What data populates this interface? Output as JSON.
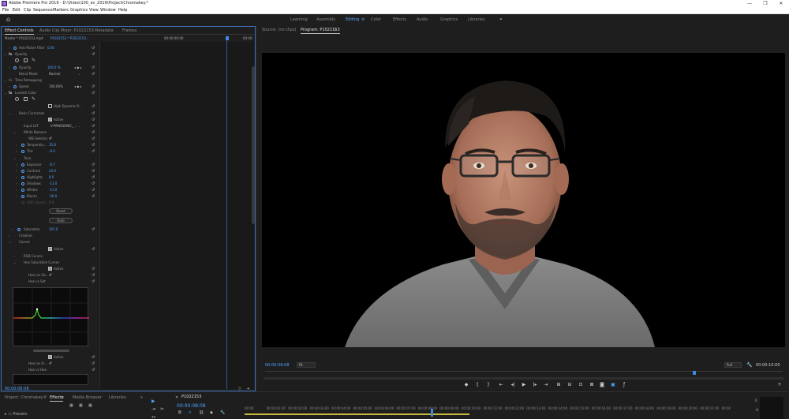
{
  "titlebar": {
    "title": "Adobe Premiere Pro 2019 - D:\\Video\\100_av_2019\\Project\\Chromakey.*",
    "minimize": "—",
    "maximize": "❐",
    "close": "✕"
  },
  "menu": [
    "File",
    "Edit",
    "Clip",
    "Sequence",
    "Markers",
    "Graphics",
    "View",
    "Window",
    "Help"
  ],
  "workspaces": {
    "items": [
      "Learning",
      "Assembly",
      "Editing",
      "Color",
      "Effects",
      "Audio",
      "Graphics",
      "Libraries"
    ],
    "active": "Editing",
    "more": "»"
  },
  "effect_controls": {
    "tabs": [
      "Effect Controls",
      "Audio Clip Mixer: P1022153",
      "Metadata",
      "Frames"
    ],
    "master": "Master * P1022153.mp4",
    "clip": "P1022153 * P1022153...",
    "tc_start": "00:00:00:00",
    "tc_end": "00:00",
    "timecode": "00:00:08:08",
    "rows": {
      "anti_flicker": {
        "label": "Anti-flicker Filter",
        "value": "0.00"
      },
      "opacity": {
        "label": "Opacity"
      },
      "opacity_value": {
        "label": "Opacity",
        "value": "100.0 %"
      },
      "blend_mode": {
        "label": "Blend Mode",
        "value": "Normal"
      },
      "time_remap": {
        "label": "Time Remapping"
      },
      "speed": {
        "label": "Speed",
        "value": "100.00%"
      },
      "lumetri": {
        "label": "Lumetri Color"
      },
      "high_dynamic": {
        "label": "High Dynamic R..."
      },
      "basic_correction": {
        "label": "Basic Correction"
      },
      "active1": {
        "label": "Active"
      },
      "input_lut": {
        "label": "Input LUT",
        "value": "V-PANASONIC_..."
      },
      "white_balance": {
        "label": "White Balance"
      },
      "wb_selector": {
        "label": "WB Selector"
      },
      "temperature": {
        "label": "Temperatu...",
        "value": "35.8"
      },
      "tint": {
        "label": "Tint",
        "value": "-9.0"
      },
      "tone": {
        "label": "Tone"
      },
      "exposure": {
        "label": "Exposure",
        "value": "-0.7"
      },
      "contrast": {
        "label": "Contrast",
        "value": "24.0"
      },
      "highlights": {
        "label": "Highlights",
        "value": "8.0"
      },
      "shadows": {
        "label": "Shadows",
        "value": "-13.0"
      },
      "whites": {
        "label": "Whites",
        "value": "-11.0"
      },
      "blacks": {
        "label": "Blacks",
        "value": "-26.0"
      },
      "hdr_specular": {
        "label": "HDR Specul...",
        "value": "0.0"
      },
      "saturation": {
        "label": "Saturation",
        "value": "107.0"
      },
      "creative": {
        "label": "Creative"
      },
      "curves": {
        "label": "Curves"
      },
      "active2": {
        "label": "Active"
      },
      "rgb_curves": {
        "label": "RGB Curves"
      },
      "hue_sat_curves": {
        "label": "Hue Saturation Curves"
      },
      "active3": {
        "label": "Active"
      },
      "hue_vs_sat_a": {
        "label": "Hue (vs Sa..."
      },
      "hue_vs_sat_b": {
        "label": "Hue vs Sat"
      },
      "active4": {
        "label": "Active"
      },
      "hue_vs_hue_a": {
        "label": "Hue (vs H..."
      },
      "hue_vs_hue_b": {
        "label": "Hue vs Hue"
      }
    },
    "buttons": {
      "reset": "Reset",
      "auto": "Auto"
    }
  },
  "program": {
    "tabs": [
      "Source: (no clips)",
      "Program: P1022153"
    ],
    "timecode": "00:00:08:08",
    "zoom": "Fit",
    "resolution": "Full",
    "duration": "00:00:10:00",
    "playhead_fraction": 0.83
  },
  "bottom": {
    "tabs": [
      "Project: Chromakey.lf",
      "Effects",
      "Media Browser",
      "Libraries"
    ],
    "more": "»",
    "presets": "Presets",
    "sequence_tab": "P1022153",
    "sequence_tc": "00:00:08:08",
    "ruler": [
      "00:00",
      "00:00:01:00",
      "00:00:02:00",
      "00:00:03:00",
      "00:00:04:00",
      "00:00:05:00",
      "00:00:06:00",
      "00:00:07:00",
      "00:00:08:00",
      "00:00:09:00",
      "00:00:10:00",
      "00:00:11:00",
      "00:00:12:00",
      "00:00:13:00",
      "00:00:14:00",
      "00:00:15:00",
      "00:00:16:00",
      "00:00:17:00",
      "00:00:18:00",
      "00:00:19:00",
      "00:00:20:00",
      "00:00:21:00",
      "00:00"
    ],
    "vu_labels": [
      "0",
      "-6"
    ]
  }
}
